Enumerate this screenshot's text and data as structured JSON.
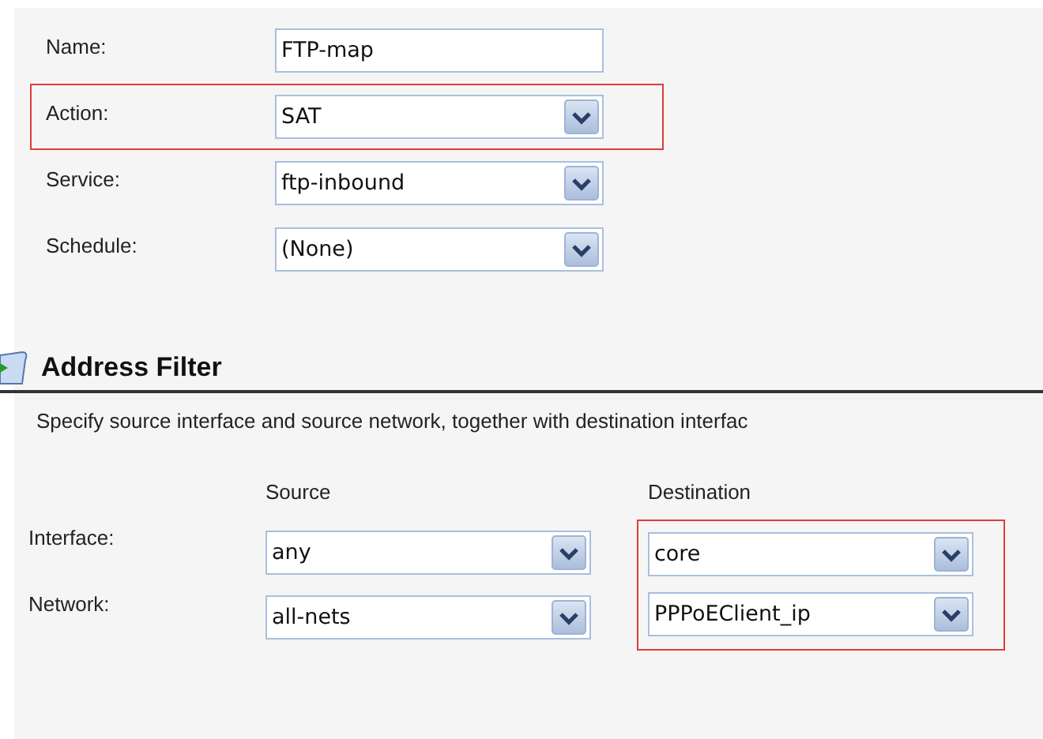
{
  "general": {
    "fields": [
      {
        "label": "Name:",
        "kind": "text",
        "value": "FTP-map",
        "highlighted": false
      },
      {
        "label": "Action:",
        "kind": "select",
        "value": "SAT",
        "highlighted": true
      },
      {
        "label": "Service:",
        "kind": "select",
        "value": "ftp-inbound",
        "highlighted": false
      },
      {
        "label": "Schedule:",
        "kind": "select",
        "value": "(None)",
        "highlighted": false
      }
    ]
  },
  "address_filter": {
    "title": "Address Filter",
    "description": "Specify source interface and source network, together with destination interfac",
    "columns": [
      "Source",
      "Destination"
    ],
    "destination_highlighted": true,
    "rows": [
      {
        "label": "Interface:",
        "source": "any",
        "destination": "core"
      },
      {
        "label": "Network:",
        "source": "all-nets",
        "destination": "PPPoEClient_ip"
      }
    ]
  }
}
